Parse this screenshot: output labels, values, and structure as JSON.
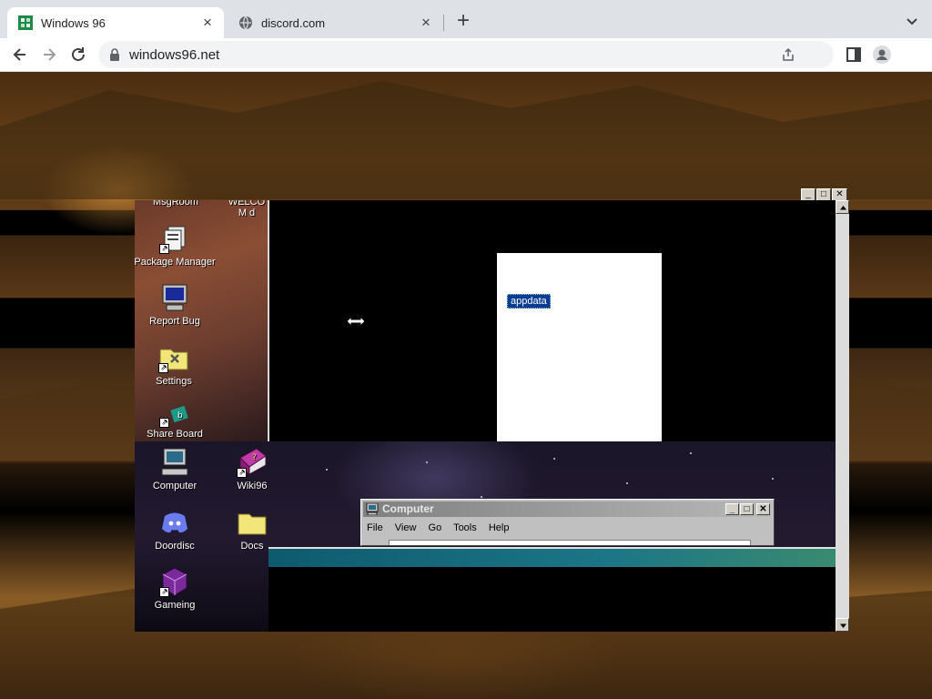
{
  "browser": {
    "tabs": [
      {
        "title": "Windows 96",
        "active": true
      },
      {
        "title": "discord.com",
        "active": false
      }
    ],
    "url": "windows96.net"
  },
  "desktop_icons": [
    {
      "id": "msgroom",
      "label": "MsgRoom"
    },
    {
      "id": "welcome",
      "label": "WELCOM d"
    },
    {
      "id": "package-manager",
      "label": "Package Manager"
    },
    {
      "id": "report-bug",
      "label": "Report Bug"
    },
    {
      "id": "settings",
      "label": "Settings"
    },
    {
      "id": "share-board",
      "label": "Share Board"
    },
    {
      "id": "computer",
      "label": "Computer"
    },
    {
      "id": "wiki96",
      "label": "Wiki96"
    },
    {
      "id": "doordisc",
      "label": "Doordisc"
    },
    {
      "id": "docs",
      "label": "Docs"
    },
    {
      "id": "gameing",
      "label": "Gameing"
    }
  ],
  "folder": {
    "selected_item": "appdata"
  },
  "computer_window": {
    "title": "Computer",
    "menu": [
      "File",
      "View",
      "Go",
      "Tools",
      "Help"
    ]
  },
  "colors": {
    "tabbar": "#dee1e6",
    "selection": "#0a3d91",
    "teal": "#1b7686"
  }
}
